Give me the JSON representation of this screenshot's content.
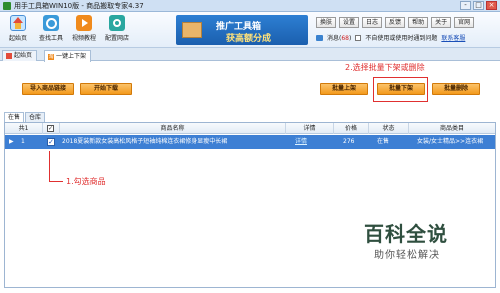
{
  "window": {
    "title": "用手工具箱WIN10版 - 商品搬取专家4.37",
    "controls": [
      "-",
      "□",
      "×"
    ]
  },
  "toolbar": {
    "tools": [
      {
        "label": "起始页",
        "icon": "home-icon"
      },
      {
        "label": "查找工具",
        "icon": "search-icon"
      },
      {
        "label": "视频教程",
        "icon": "video-icon"
      },
      {
        "label": "配置网店",
        "icon": "gear-icon"
      }
    ],
    "banner": {
      "line1": "推广工具箱",
      "line2": "获高额分成"
    },
    "top_buttons": [
      "换肤",
      "设置",
      "日志",
      "反馈",
      "帮助",
      "关于",
      "官网"
    ],
    "messages_label": "消息(",
    "messages_count": "68",
    "messages_close": ")",
    "auto_open_text": "不自使用或使用时通到问题",
    "contact_link": "联系客服"
  },
  "page_tabs": [
    {
      "label": "起始页"
    },
    {
      "label": "一键上下架",
      "icon_text": "淘"
    }
  ],
  "actions": {
    "import": "导入商品链接",
    "start": "开始下载",
    "batch_up": "批量上架",
    "batch_down": "批量下架",
    "batch_delete": "批量删除"
  },
  "annotations": {
    "step2": "2.选择批量下架或删除",
    "step1": "1.勾选商品"
  },
  "inner_tabs": [
    "在售",
    "仓库"
  ],
  "grid": {
    "headers": {
      "count": "共1",
      "name": "商品名称",
      "detail": "详情",
      "price": "价格",
      "status": "状态",
      "category": "商品类目"
    },
    "rows": [
      {
        "index": "1",
        "name": "2018夏装新款女装高松风格子短袖纯棉连衣裙修身显瘦中长裙",
        "detail": "详情",
        "price": "276",
        "status": "在售",
        "category": "女装/女士精品>>连衣裙"
      }
    ]
  },
  "watermark": {
    "line1": "百科全说",
    "line2": "助你轻松解决"
  },
  "colors": {
    "accent": "#f39a1c",
    "selection": "#3d7fd4",
    "annotation": "#e03030"
  }
}
